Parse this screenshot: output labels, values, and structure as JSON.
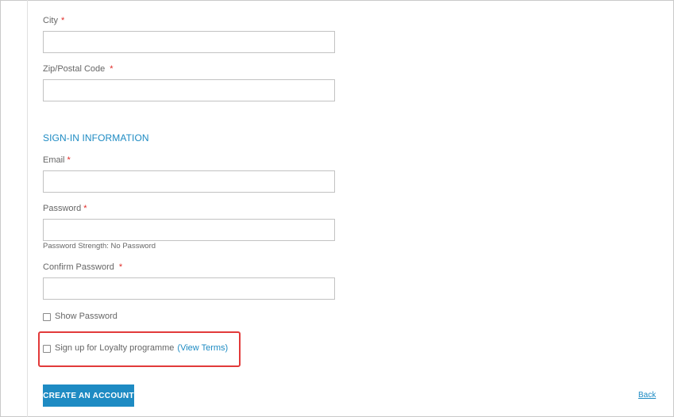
{
  "form": {
    "city": {
      "label": "City",
      "required": "*",
      "value": ""
    },
    "zip": {
      "label": "Zip/Postal Code",
      "required": "*",
      "value": ""
    },
    "signin_section": {
      "title": "SIGN-IN INFORMATION"
    },
    "email": {
      "label": "Email",
      "required": "*",
      "value": ""
    },
    "password": {
      "label": "Password",
      "required": "*",
      "value": "",
      "strength_text": "Password Strength: No Password"
    },
    "confirm_password": {
      "label": "Confirm Password",
      "required": "*",
      "value": ""
    },
    "show_password": {
      "label": "Show Password"
    },
    "loyalty": {
      "label": "Sign up for Loyalty programme",
      "link_text": "(View Terms)"
    },
    "submit_label": "CREATE AN ACCOUNT",
    "back_label": "Back"
  },
  "colors": {
    "accent": "#1e8bc3",
    "required": "#e02b27",
    "highlight": "#e23a3a"
  }
}
